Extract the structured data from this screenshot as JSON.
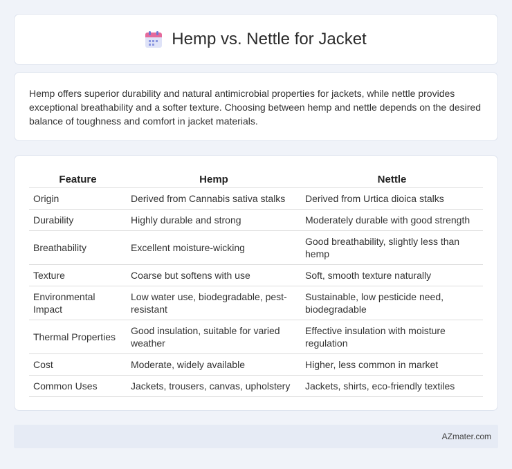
{
  "header": {
    "title": "Hemp vs. Nettle for Jacket",
    "icon": "calendar-icon"
  },
  "description": "Hemp offers superior durability and natural antimicrobial properties for jackets, while nettle provides exceptional breathability and a softer texture. Choosing between hemp and nettle depends on the desired balance of toughness and comfort in jacket materials.",
  "table": {
    "headers": [
      "Feature",
      "Hemp",
      "Nettle"
    ],
    "rows": [
      [
        "Origin",
        "Derived from Cannabis sativa stalks",
        "Derived from Urtica dioica stalks"
      ],
      [
        "Durability",
        "Highly durable and strong",
        "Moderately durable with good strength"
      ],
      [
        "Breathability",
        "Excellent moisture-wicking",
        "Good breathability, slightly less than hemp"
      ],
      [
        "Texture",
        "Coarse but softens with use",
        "Soft, smooth texture naturally"
      ],
      [
        "Environmental Impact",
        "Low water use, biodegradable, pest-resistant",
        "Sustainable, low pesticide need, biodegradable"
      ],
      [
        "Thermal Properties",
        "Good insulation, suitable for varied weather",
        "Effective insulation with moisture regulation"
      ],
      [
        "Cost",
        "Moderate, widely available",
        "Higher, less common in market"
      ],
      [
        "Common Uses",
        "Jackets, trousers, canvas, upholstery",
        "Jackets, shirts, eco-friendly textiles"
      ]
    ]
  },
  "footer": {
    "brand": "AZmater.com"
  }
}
